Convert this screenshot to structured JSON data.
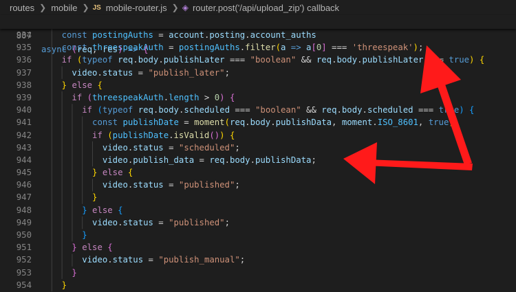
{
  "breadcrumb": {
    "items": [
      "routes",
      "mobile",
      "mobile-router.js",
      "router.post('/api/upload_zip') callback"
    ],
    "js_badge": "JS",
    "icon_names": [
      "chevron-right-icon",
      "js-file-icon",
      "symbol-method-icon"
    ]
  },
  "sticky": {
    "line_number": "807",
    "tokens": [
      {
        "t": "async ",
        "c": "kw"
      },
      {
        "t": "(",
        "c": "br2"
      },
      {
        "t": "req",
        "c": "var"
      },
      {
        "t": ", ",
        "c": "op"
      },
      {
        "t": "res",
        "c": "var"
      },
      {
        "t": ") ",
        "c": "br2"
      },
      {
        "t": "=> ",
        "c": "kw"
      },
      {
        "t": "{",
        "c": "br2"
      }
    ]
  },
  "code_lines": [
    {
      "n": "934",
      "indent": 4,
      "tokens": [
        {
          "t": "const ",
          "c": "kw"
        },
        {
          "t": "postingAuths",
          "c": "cst"
        },
        {
          "t": " = ",
          "c": "op"
        },
        {
          "t": "account",
          "c": "var"
        },
        {
          "t": ".",
          "c": "op"
        },
        {
          "t": "posting",
          "c": "var"
        },
        {
          "t": ".",
          "c": "op"
        },
        {
          "t": "account_auths",
          "c": "var"
        }
      ]
    },
    {
      "n": "935",
      "indent": 4,
      "tokens": [
        {
          "t": "const ",
          "c": "kw"
        },
        {
          "t": "threespeakAuth",
          "c": "cst"
        },
        {
          "t": " = ",
          "c": "op"
        },
        {
          "t": "postingAuths",
          "c": "cst"
        },
        {
          "t": ".",
          "c": "op"
        },
        {
          "t": "filter",
          "c": "fn"
        },
        {
          "t": "(",
          "c": "br1"
        },
        {
          "t": "a",
          "c": "var"
        },
        {
          "t": " => ",
          "c": "kw"
        },
        {
          "t": "a",
          "c": "var"
        },
        {
          "t": "[",
          "c": "br2"
        },
        {
          "t": "0",
          "c": "num"
        },
        {
          "t": "]",
          "c": "br2"
        },
        {
          "t": " === ",
          "c": "op"
        },
        {
          "t": "'threespeak'",
          "c": "str"
        },
        {
          "t": ")",
          "c": "br1"
        },
        {
          "t": ";",
          "c": "op"
        }
      ]
    },
    {
      "n": "936",
      "indent": 4,
      "tokens": [
        {
          "t": "if ",
          "c": "ctl"
        },
        {
          "t": "(",
          "c": "br1"
        },
        {
          "t": "typeof ",
          "c": "kw"
        },
        {
          "t": "req",
          "c": "var"
        },
        {
          "t": ".",
          "c": "op"
        },
        {
          "t": "body",
          "c": "var"
        },
        {
          "t": ".",
          "c": "op"
        },
        {
          "t": "publishLater",
          "c": "var"
        },
        {
          "t": " === ",
          "c": "op"
        },
        {
          "t": "\"boolean\"",
          "c": "str"
        },
        {
          "t": " && ",
          "c": "op"
        },
        {
          "t": "req",
          "c": "var"
        },
        {
          "t": ".",
          "c": "op"
        },
        {
          "t": "body",
          "c": "var"
        },
        {
          "t": ".",
          "c": "op"
        },
        {
          "t": "publishLater",
          "c": "var"
        },
        {
          "t": " === ",
          "c": "op"
        },
        {
          "t": "true",
          "c": "kw"
        },
        {
          "t": ") ",
          "c": "br1"
        },
        {
          "t": "{",
          "c": "br1"
        }
      ]
    },
    {
      "n": "937",
      "indent": 6,
      "tokens": [
        {
          "t": "video",
          "c": "var"
        },
        {
          "t": ".",
          "c": "op"
        },
        {
          "t": "status",
          "c": "var"
        },
        {
          "t": " = ",
          "c": "op"
        },
        {
          "t": "\"publish_later\"",
          "c": "str"
        },
        {
          "t": ";",
          "c": "op"
        }
      ]
    },
    {
      "n": "938",
      "indent": 4,
      "tokens": [
        {
          "t": "} ",
          "c": "br1"
        },
        {
          "t": "else ",
          "c": "ctl"
        },
        {
          "t": "{",
          "c": "br1"
        }
      ]
    },
    {
      "n": "939",
      "indent": 6,
      "tokens": [
        {
          "t": "if ",
          "c": "ctl"
        },
        {
          "t": "(",
          "c": "br2"
        },
        {
          "t": "threespeakAuth",
          "c": "cst"
        },
        {
          "t": ".",
          "c": "op"
        },
        {
          "t": "length",
          "c": "cst"
        },
        {
          "t": " > ",
          "c": "op"
        },
        {
          "t": "0",
          "c": "num"
        },
        {
          "t": ") ",
          "c": "br2"
        },
        {
          "t": "{",
          "c": "br2"
        }
      ]
    },
    {
      "n": "940",
      "indent": 8,
      "tokens": [
        {
          "t": "if ",
          "c": "ctl"
        },
        {
          "t": "(",
          "c": "br3"
        },
        {
          "t": "typeof ",
          "c": "kw"
        },
        {
          "t": "req",
          "c": "var"
        },
        {
          "t": ".",
          "c": "op"
        },
        {
          "t": "body",
          "c": "var"
        },
        {
          "t": ".",
          "c": "op"
        },
        {
          "t": "scheduled",
          "c": "var"
        },
        {
          "t": " === ",
          "c": "op"
        },
        {
          "t": "\"boolean\"",
          "c": "str"
        },
        {
          "t": " && ",
          "c": "op"
        },
        {
          "t": "req",
          "c": "var"
        },
        {
          "t": ".",
          "c": "op"
        },
        {
          "t": "body",
          "c": "var"
        },
        {
          "t": ".",
          "c": "op"
        },
        {
          "t": "scheduled",
          "c": "var"
        },
        {
          "t": " === ",
          "c": "op"
        },
        {
          "t": "true",
          "c": "kw"
        },
        {
          "t": ") ",
          "c": "br3"
        },
        {
          "t": "{",
          "c": "br3"
        }
      ]
    },
    {
      "n": "941",
      "indent": 10,
      "tokens": [
        {
          "t": "const ",
          "c": "kw"
        },
        {
          "t": "publishDate",
          "c": "cst"
        },
        {
          "t": " = ",
          "c": "op"
        },
        {
          "t": "moment",
          "c": "fn"
        },
        {
          "t": "(",
          "c": "br1"
        },
        {
          "t": "req",
          "c": "var"
        },
        {
          "t": ".",
          "c": "op"
        },
        {
          "t": "body",
          "c": "var"
        },
        {
          "t": ".",
          "c": "op"
        },
        {
          "t": "publishData",
          "c": "var"
        },
        {
          "t": ", ",
          "c": "op"
        },
        {
          "t": "moment",
          "c": "var"
        },
        {
          "t": ".",
          "c": "op"
        },
        {
          "t": "ISO_8601",
          "c": "cst"
        },
        {
          "t": ", ",
          "c": "op"
        },
        {
          "t": "true",
          "c": "kw"
        },
        {
          "t": ")",
          "c": "br1"
        },
        {
          "t": ";",
          "c": "op"
        }
      ]
    },
    {
      "n": "942",
      "indent": 10,
      "tokens": [
        {
          "t": "if ",
          "c": "ctl"
        },
        {
          "t": "(",
          "c": "br1"
        },
        {
          "t": "publishDate",
          "c": "cst"
        },
        {
          "t": ".",
          "c": "op"
        },
        {
          "t": "isValid",
          "c": "fn"
        },
        {
          "t": "()",
          "c": "br2"
        },
        {
          "t": ") ",
          "c": "br1"
        },
        {
          "t": "{",
          "c": "br1"
        }
      ]
    },
    {
      "n": "943",
      "indent": 12,
      "tokens": [
        {
          "t": "video",
          "c": "var"
        },
        {
          "t": ".",
          "c": "op"
        },
        {
          "t": "status",
          "c": "var"
        },
        {
          "t": " = ",
          "c": "op"
        },
        {
          "t": "\"scheduled\"",
          "c": "str"
        },
        {
          "t": ";",
          "c": "op"
        }
      ]
    },
    {
      "n": "944",
      "indent": 12,
      "tokens": [
        {
          "t": "video",
          "c": "var"
        },
        {
          "t": ".",
          "c": "op"
        },
        {
          "t": "publish_data",
          "c": "var"
        },
        {
          "t": " = ",
          "c": "op"
        },
        {
          "t": "req",
          "c": "var"
        },
        {
          "t": ".",
          "c": "op"
        },
        {
          "t": "body",
          "c": "var"
        },
        {
          "t": ".",
          "c": "op"
        },
        {
          "t": "publishData",
          "c": "var"
        },
        {
          "t": ";",
          "c": "op"
        }
      ]
    },
    {
      "n": "945",
      "indent": 10,
      "tokens": [
        {
          "t": "} ",
          "c": "br1"
        },
        {
          "t": "else ",
          "c": "ctl"
        },
        {
          "t": "{",
          "c": "br1"
        }
      ]
    },
    {
      "n": "946",
      "indent": 12,
      "tokens": [
        {
          "t": "video",
          "c": "var"
        },
        {
          "t": ".",
          "c": "op"
        },
        {
          "t": "status",
          "c": "var"
        },
        {
          "t": " = ",
          "c": "op"
        },
        {
          "t": "\"published\"",
          "c": "str"
        },
        {
          "t": ";",
          "c": "op"
        }
      ]
    },
    {
      "n": "947",
      "indent": 10,
      "tokens": [
        {
          "t": "}",
          "c": "br1"
        }
      ]
    },
    {
      "n": "948",
      "indent": 8,
      "tokens": [
        {
          "t": "} ",
          "c": "br3"
        },
        {
          "t": "else ",
          "c": "ctl"
        },
        {
          "t": "{",
          "c": "br3"
        }
      ]
    },
    {
      "n": "949",
      "indent": 10,
      "tokens": [
        {
          "t": "video",
          "c": "var"
        },
        {
          "t": ".",
          "c": "op"
        },
        {
          "t": "status",
          "c": "var"
        },
        {
          "t": " = ",
          "c": "op"
        },
        {
          "t": "\"published\"",
          "c": "str"
        },
        {
          "t": ";",
          "c": "op"
        }
      ]
    },
    {
      "n": "950",
      "indent": 8,
      "tokens": [
        {
          "t": "}",
          "c": "br3"
        }
      ]
    },
    {
      "n": "951",
      "indent": 6,
      "tokens": [
        {
          "t": "} ",
          "c": "br2"
        },
        {
          "t": "else ",
          "c": "ctl"
        },
        {
          "t": "{",
          "c": "br2"
        }
      ]
    },
    {
      "n": "952",
      "indent": 8,
      "tokens": [
        {
          "t": "video",
          "c": "var"
        },
        {
          "t": ".",
          "c": "op"
        },
        {
          "t": "status",
          "c": "var"
        },
        {
          "t": " = ",
          "c": "op"
        },
        {
          "t": "\"publish_manual\"",
          "c": "str"
        },
        {
          "t": ";",
          "c": "op"
        }
      ]
    },
    {
      "n": "953",
      "indent": 6,
      "tokens": [
        {
          "t": "}",
          "c": "br2"
        }
      ]
    },
    {
      "n": "954",
      "indent": 4,
      "tokens": [
        {
          "t": "}",
          "c": "br1"
        }
      ]
    }
  ],
  "theme": {
    "background": "#1e1e1e",
    "annotation_color": "#ff1a1a"
  },
  "annotations": [
    {
      "name": "red-arrow-up",
      "points_to": "publishLater"
    },
    {
      "name": "red-arrow-left",
      "points_to": "req.body.publishData"
    }
  ]
}
